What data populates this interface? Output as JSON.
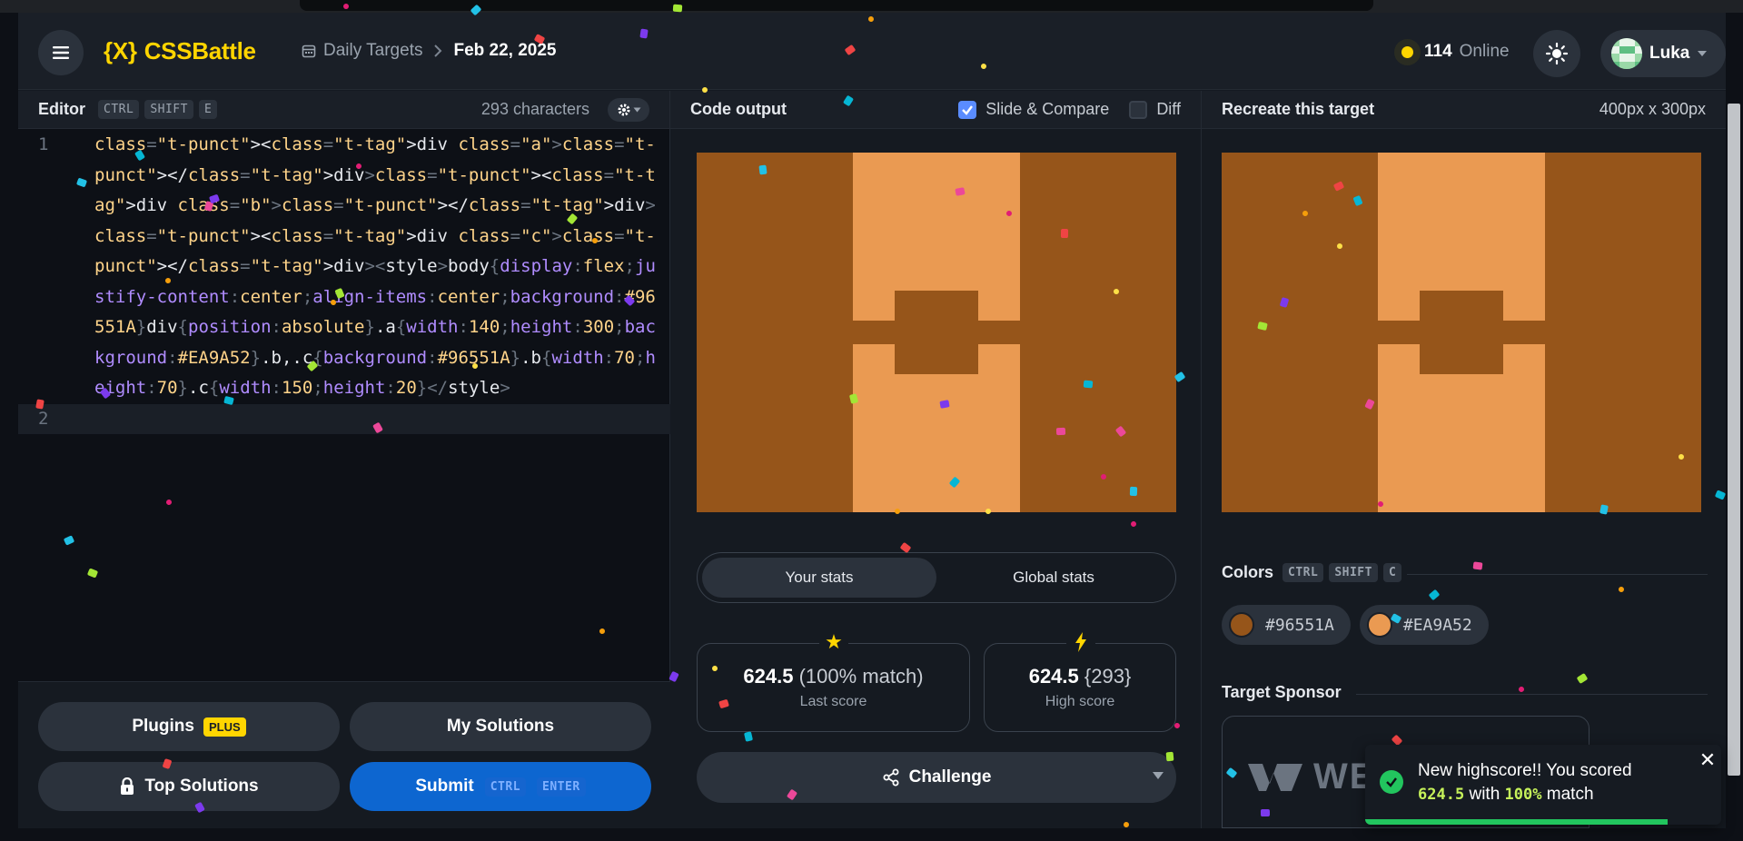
{
  "header": {
    "logo_mark": "{X}",
    "logo_text": "CSSBattle",
    "breadcrumb_parent": "Daily Targets",
    "breadcrumb_current": "Feb 22, 2025",
    "online_count": "114",
    "online_label": "Online",
    "user_name": "Luka"
  },
  "editor": {
    "title": "Editor",
    "shortcut": [
      "CTRL",
      "SHIFT",
      "E"
    ],
    "char_count": "293 characters",
    "line_numbers": [
      "1",
      "2"
    ],
    "code": "<div class=\"a\"></div><div class=\"b\"></div><div class=\"c\"></div><style>body{display:flex;justify-content:center;align-items:center;background:#96551A}div{position:absolute}.a{width:140;height:300;background:#EA9A52}.b,.c{background:#96551A}.b{width:70;height:70}.c{width:150;height:20}</style>"
  },
  "buttons": {
    "plugins": "Plugins",
    "plus_badge": "PLUS",
    "my_solutions": "My Solutions",
    "top_solutions": "Top Solutions",
    "submit": "Submit",
    "submit_shortcut": [
      "CTRL",
      "ENTER"
    ]
  },
  "output": {
    "title": "Code output",
    "slide_compare_label": "Slide & Compare",
    "slide_compare_checked": true,
    "diff_label": "Diff",
    "diff_checked": false
  },
  "stats": {
    "tabs": [
      "Your stats",
      "Global stats"
    ],
    "active_tab": "Your stats",
    "last_score": "624.5",
    "last_match": "(100% match)",
    "last_label": "Last score",
    "high_score": "624.5",
    "high_chars": "{293}",
    "high_label": "High score",
    "challenge_label": "Challenge"
  },
  "target": {
    "title": "Recreate this target",
    "dimensions": "400px x 300px",
    "colors_title": "Colors",
    "colors_shortcut": [
      "CTRL",
      "SHIFT",
      "C"
    ],
    "colors": [
      "#96551A",
      "#EA9A52"
    ],
    "sponsor_title": "Target Sponsor",
    "sponsor_logo_text": "WE"
  },
  "toast": {
    "text_before": "New highscore!! You scored",
    "score": "624.5",
    "with": "with",
    "match": "100%",
    "match_suffix": "match",
    "progress_fraction": 0.85
  },
  "colors": {
    "accent_yellow": "#ffd500",
    "submit_blue": "#0d66d0",
    "success_green": "#22c55e"
  },
  "icons": [
    "menu-icon",
    "calendar-icon",
    "chevron-right-icon",
    "sun-icon",
    "chevron-down-icon",
    "gear-icon",
    "lock-icon",
    "share-icon",
    "star-icon",
    "bolt-icon",
    "check-circle-icon",
    "close-icon"
  ]
}
